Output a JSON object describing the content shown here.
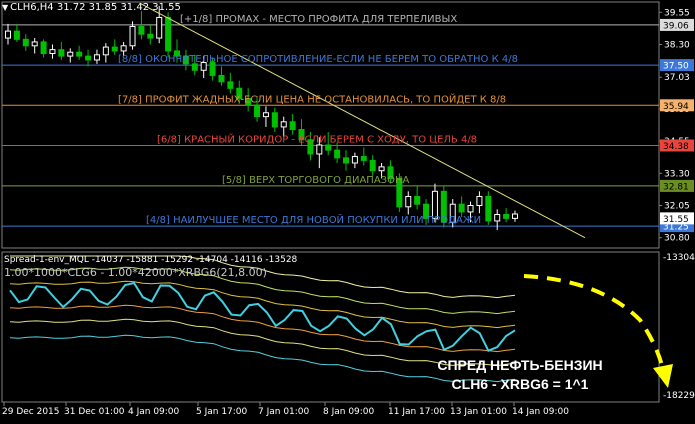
{
  "window": {
    "symbol_line": "CLH6,H4  31.72 31.85 31.42 31.55"
  },
  "main_pane": {
    "price_scale": [
      "39.55",
      "38.30",
      "37.03",
      "35.80",
      "34.55",
      "33.30",
      "32.05",
      "30.80"
    ],
    "levels": [
      {
        "id": "l1",
        "text": "[+1/8] ПРОМАХ - МЕСТО ПРОФИТА ДЛЯ ТЕРПЕЛИВЫХ",
        "price": 39.06,
        "badge": "39.06",
        "color": "#b4b4b4",
        "badge_bg": "#dcdcdc",
        "badge_fg": "#000000"
      },
      {
        "id": "l2",
        "text": "[8/8] ОКОНЧАТЕЛЬНОЕ СОПРОТИВЛЕНИЕ-ЕСЛИ НЕ БЕРЕМ ТО ОБРАТНО К 4/8",
        "price": 37.5,
        "badge": "37.50",
        "color": "#3c78d8",
        "badge_bg": "#3c78d8",
        "badge_fg": "#ffffff"
      },
      {
        "id": "l3",
        "text": "[7/8] ПРОФИТ ЖАДНЫХ-ЕСЛИ ЦЕНА НЕ ОСТАНОВИЛАСЬ, ТО ПОЙДЕТ К 8/8",
        "price": 35.94,
        "badge": "35.94",
        "color": "#e69138",
        "badge_bg": "#f6b26b",
        "badge_fg": "#000000"
      },
      {
        "id": "l4",
        "text": "[6/8] КРАСНЫЙ КОРИДОР - ЕСЛИ БЕРЕМ С ХОДУ, ТО ЦЕЛЬ 4/8",
        "price": 34.38,
        "badge": "34.38",
        "color": "#e8453c",
        "badge_bg": "#e8453c",
        "badge_fg": "#000000"
      },
      {
        "id": "l5",
        "text": "[5/8] ВЕРХ ТОРГОВОГО ДИАПАЗОНА",
        "price": 32.81,
        "badge": "32.81",
        "color": "#7fa23c",
        "badge_bg": "#6b8e23",
        "badge_fg": "#000000"
      },
      {
        "id": "l6",
        "text": "[4/8] НАИЛУЧШЕЕ МЕСТО ДЛЯ НОВОЙ ПОКУПКИ ИЛИ ПРОДАЖИ",
        "price": 31.25,
        "badge": "31.25",
        "color": "#3c78d8",
        "badge_bg": "#3c78d8",
        "badge_fg": "#ffffff"
      }
    ],
    "last_price_badge": "31.55"
  },
  "osc_pane": {
    "title": "Spread-1-env_MQL -14037 -15881 -15292 -14704 -14116 -13528",
    "formula": "1.00*1000*CLG6 - 1.00*42000*XRBG6(21,8.00)",
    "scale_top": "-13304",
    "scale_bottom": "-18229"
  },
  "time_axis": [
    "29 Dec 2015",
    "31 Dec 01:00",
    "4 Jan 09:00",
    "5 Jan 17:00",
    "7 Jan 01:00",
    "8 Jan 09:00",
    "11 Jan 17:00",
    "13 Jan 01:00",
    "14 Jan 09:00"
  ],
  "annotation": {
    "line1": "СПРЕД НЕФТЬ-БЕНЗИН",
    "line2": "CLH6 - XRBG6 = 1^1"
  },
  "colors": {
    "bull_candle": "#ffffff",
    "bear_candle": "#00c000",
    "trend_line": "#e0e080",
    "osc_line": "#40d0e0",
    "arrow": "#ffff00"
  },
  "chart_data": {
    "type": "candlestick",
    "candles": [
      {
        "o": 38.55,
        "h": 39.1,
        "l": 38.3,
        "c": 38.82
      },
      {
        "o": 38.82,
        "h": 39.1,
        "l": 38.4,
        "c": 38.5
      },
      {
        "o": 38.5,
        "h": 38.7,
        "l": 38.05,
        "c": 38.25
      },
      {
        "o": 38.25,
        "h": 38.55,
        "l": 37.95,
        "c": 38.4
      },
      {
        "o": 38.4,
        "h": 38.5,
        "l": 37.8,
        "c": 37.95
      },
      {
        "o": 37.95,
        "h": 38.3,
        "l": 37.75,
        "c": 38.1
      },
      {
        "o": 38.1,
        "h": 38.4,
        "l": 37.7,
        "c": 37.85
      },
      {
        "o": 37.85,
        "h": 38.15,
        "l": 37.6,
        "c": 38.0
      },
      {
        "o": 38.0,
        "h": 38.25,
        "l": 37.7,
        "c": 37.85
      },
      {
        "o": 37.85,
        "h": 38.1,
        "l": 37.45,
        "c": 37.7
      },
      {
        "o": 37.7,
        "h": 38.1,
        "l": 37.55,
        "c": 37.9
      },
      {
        "o": 37.9,
        "h": 38.35,
        "l": 37.6,
        "c": 38.2
      },
      {
        "o": 38.2,
        "h": 38.5,
        "l": 37.9,
        "c": 38.05
      },
      {
        "o": 38.05,
        "h": 38.4,
        "l": 37.85,
        "c": 38.25
      },
      {
        "o": 38.25,
        "h": 39.2,
        "l": 38.1,
        "c": 39.0
      },
      {
        "o": 39.0,
        "h": 39.6,
        "l": 38.5,
        "c": 38.7
      },
      {
        "o": 38.7,
        "h": 39.05,
        "l": 38.3,
        "c": 38.55
      },
      {
        "o": 38.55,
        "h": 39.8,
        "l": 38.35,
        "c": 39.35
      },
      {
        "o": 39.35,
        "h": 39.55,
        "l": 37.8,
        "c": 38.05
      },
      {
        "o": 38.05,
        "h": 38.5,
        "l": 37.6,
        "c": 37.85
      },
      {
        "o": 37.85,
        "h": 38.1,
        "l": 37.3,
        "c": 37.55
      },
      {
        "o": 37.55,
        "h": 37.9,
        "l": 37.1,
        "c": 37.3
      },
      {
        "o": 37.3,
        "h": 37.85,
        "l": 37.0,
        "c": 37.6
      },
      {
        "o": 37.6,
        "h": 37.8,
        "l": 36.9,
        "c": 37.1
      },
      {
        "o": 37.1,
        "h": 37.45,
        "l": 36.7,
        "c": 36.85
      },
      {
        "o": 36.85,
        "h": 37.2,
        "l": 36.4,
        "c": 36.6
      },
      {
        "o": 36.6,
        "h": 36.9,
        "l": 36.0,
        "c": 36.2
      },
      {
        "o": 36.2,
        "h": 36.6,
        "l": 35.7,
        "c": 35.95
      },
      {
        "o": 35.95,
        "h": 36.3,
        "l": 35.3,
        "c": 35.5
      },
      {
        "o": 35.5,
        "h": 35.9,
        "l": 35.1,
        "c": 35.65
      },
      {
        "o": 35.65,
        "h": 35.85,
        "l": 34.9,
        "c": 35.1
      },
      {
        "o": 35.1,
        "h": 35.5,
        "l": 34.7,
        "c": 35.3
      },
      {
        "o": 35.3,
        "h": 35.6,
        "l": 34.8,
        "c": 35.0
      },
      {
        "o": 35.0,
        "h": 35.4,
        "l": 34.4,
        "c": 34.6
      },
      {
        "o": 34.6,
        "h": 34.9,
        "l": 33.8,
        "c": 34.05
      },
      {
        "o": 34.05,
        "h": 34.7,
        "l": 33.5,
        "c": 34.4
      },
      {
        "o": 34.4,
        "h": 34.9,
        "l": 34.0,
        "c": 34.2
      },
      {
        "o": 34.2,
        "h": 34.5,
        "l": 33.7,
        "c": 33.9
      },
      {
        "o": 33.9,
        "h": 34.2,
        "l": 33.4,
        "c": 33.7
      },
      {
        "o": 33.7,
        "h": 34.1,
        "l": 33.5,
        "c": 33.95
      },
      {
        "o": 33.95,
        "h": 34.3,
        "l": 33.6,
        "c": 33.8
      },
      {
        "o": 33.8,
        "h": 34.0,
        "l": 33.2,
        "c": 33.4
      },
      {
        "o": 33.4,
        "h": 33.7,
        "l": 33.1,
        "c": 33.55
      },
      {
        "o": 33.55,
        "h": 33.8,
        "l": 32.9,
        "c": 33.1
      },
      {
        "o": 33.1,
        "h": 33.3,
        "l": 31.8,
        "c": 32.0
      },
      {
        "o": 32.0,
        "h": 32.6,
        "l": 31.7,
        "c": 32.4
      },
      {
        "o": 32.4,
        "h": 32.8,
        "l": 31.9,
        "c": 32.1
      },
      {
        "o": 32.1,
        "h": 32.3,
        "l": 31.3,
        "c": 31.55
      },
      {
        "o": 31.55,
        "h": 32.9,
        "l": 31.4,
        "c": 32.6
      },
      {
        "o": 32.6,
        "h": 32.8,
        "l": 31.2,
        "c": 31.4
      },
      {
        "o": 31.4,
        "h": 32.3,
        "l": 31.2,
        "c": 32.1
      },
      {
        "o": 32.1,
        "h": 32.4,
        "l": 31.6,
        "c": 31.8
      },
      {
        "o": 31.8,
        "h": 32.2,
        "l": 31.4,
        "c": 32.05
      },
      {
        "o": 32.05,
        "h": 32.6,
        "l": 31.75,
        "c": 32.4
      },
      {
        "o": 32.4,
        "h": 32.6,
        "l": 31.3,
        "c": 31.45
      },
      {
        "o": 31.45,
        "h": 31.9,
        "l": 31.1,
        "c": 31.7
      },
      {
        "o": 31.7,
        "h": 31.95,
        "l": 31.4,
        "c": 31.55
      },
      {
        "o": 31.55,
        "h": 31.85,
        "l": 31.42,
        "c": 31.72
      }
    ],
    "envelope_levels": [
      -14037,
      -15881,
      -15292,
      -14704,
      -14116,
      -13528
    ]
  }
}
